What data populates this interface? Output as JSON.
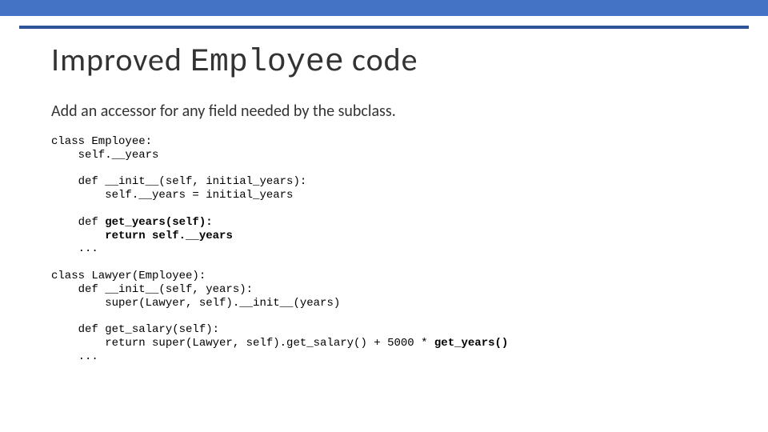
{
  "title": {
    "pre": "Improved ",
    "mono": "Employee",
    "post": "code"
  },
  "subtitle": "Add an accessor for any field needed by the subclass.",
  "code": {
    "l1": "class Employee:",
    "l2": "    self.__years",
    "l3": "",
    "l4": "    def __init__(self, initial_years):",
    "l5": "        self.__years = initial_years",
    "l6": "",
    "l7a": "    def ",
    "l7b": "get_years(self):",
    "l8a": "        ",
    "l8b": "return self.__years",
    "l9": "    ...",
    "l10": "",
    "l11": "class Lawyer(Employee):",
    "l12": "    def __init__(self, years):",
    "l13": "        super(Lawyer, self).__init__(years)",
    "l14": "",
    "l15": "    def get_salary(self):",
    "l16a": "        return super(Lawyer, self).get_salary() + 5000 * ",
    "l16b": "get_years()",
    "l17": "    ..."
  }
}
